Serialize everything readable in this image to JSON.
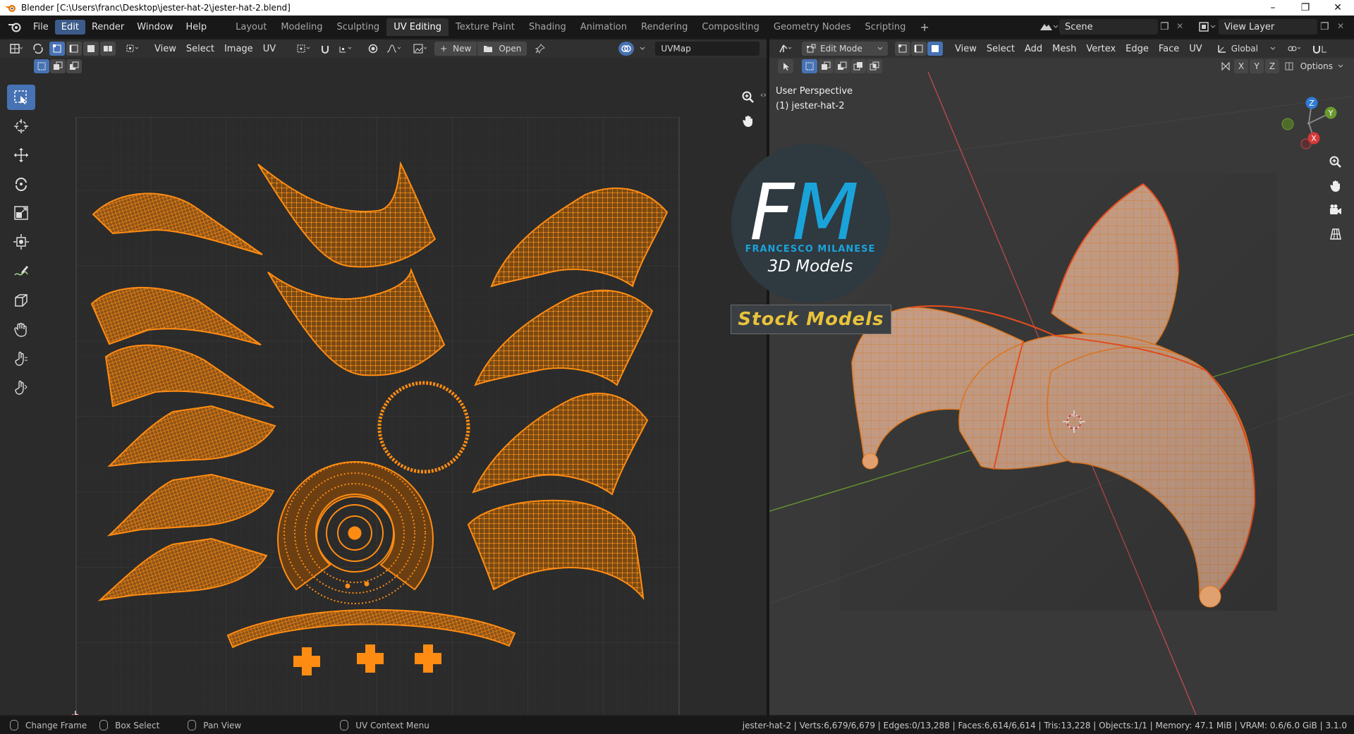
{
  "window": {
    "title": "Blender [C:\\Users\\franc\\Desktop\\jester-hat-2\\jester-hat-2.blend]",
    "minimize_glyph": "–",
    "maximize_glyph": "❐",
    "close_glyph": "✕"
  },
  "menubar": {
    "items": [
      "File",
      "Edit",
      "Render",
      "Window",
      "Help"
    ],
    "active": "Edit"
  },
  "workspaces": {
    "tabs": [
      "Layout",
      "Modeling",
      "Sculpting",
      "UV Editing",
      "Texture Paint",
      "Shading",
      "Animation",
      "Rendering",
      "Compositing",
      "Geometry Nodes",
      "Scripting"
    ],
    "active": "UV Editing",
    "add_glyph": "+"
  },
  "scene": {
    "label": "Scene"
  },
  "view_layer": {
    "label": "View Layer"
  },
  "uv_editor": {
    "menus": [
      "View",
      "Select",
      "Image",
      "UV"
    ],
    "new_label": "New",
    "open_label": "Open",
    "uvmap_value": "UVMap"
  },
  "viewport": {
    "mode_label": "Edit Mode",
    "menus": [
      "View",
      "Select",
      "Add",
      "Mesh",
      "Vertex",
      "Edge",
      "Face",
      "UV"
    ],
    "orientation_label": "Global",
    "options_label": "Options",
    "axis_labels": [
      "X",
      "Y",
      "Z"
    ],
    "overlay_line1": "User Perspective",
    "overlay_line2": "(1) jester-hat-2",
    "gizmo": {
      "x": "X",
      "y": "Y",
      "z": "Z"
    }
  },
  "watermark": {
    "monogram_f": "F",
    "monogram_m": "M",
    "name": "FRANCESCO MILANESE",
    "subtitle": "3D Models",
    "stock": "Stock Models"
  },
  "statusbar": {
    "hints": [
      "Change Frame",
      "Box Select",
      "Pan View",
      "UV Context Menu"
    ],
    "stats": "jester-hat-2 | Verts:6,679/6,679 | Edges:0/13,288 | Faces:6,614/6,614 | Tris:13,228 | Objects:1/1 | Memory: 47.1 MiB | VRAM: 0.6/6.0 GiB | 3.1.0"
  },
  "colors": {
    "uv_orange": "#ff8c12",
    "active_blue": "#4772b3",
    "fm_blue": "#1aa3d9",
    "stock_yellow": "#e8c33a",
    "axis_red": "#c84848",
    "axis_green": "#6a9a2e"
  }
}
